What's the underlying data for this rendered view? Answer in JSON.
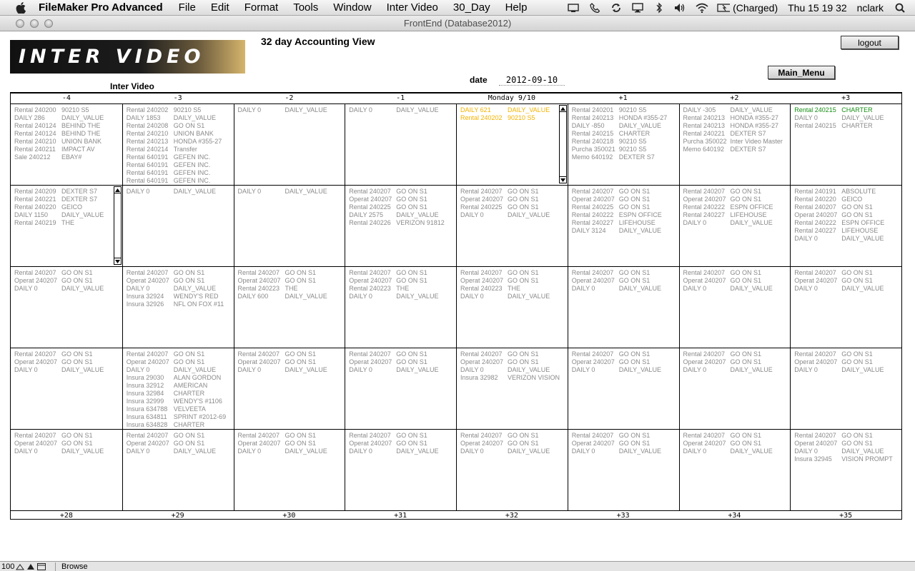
{
  "menubar": {
    "app_name": "FileMaker Pro Advanced",
    "items": [
      "File",
      "Edit",
      "Format",
      "Tools",
      "Window",
      "Inter Video",
      "30_Day",
      "Help"
    ],
    "battery": "(Charged)",
    "clock": "Thu 15 19 32",
    "user": "nclark"
  },
  "window": {
    "title": "FrontEnd (Database2012)"
  },
  "header": {
    "logo_text": "INTER VIDEO",
    "view_title": "32 day Accounting View",
    "company": "Inter Video",
    "date_label": "date",
    "date_value": "2012-09-10",
    "logout_label": "logout",
    "main_menu_label": "Main_Menu"
  },
  "calendar": {
    "headers": [
      "-4",
      "-3",
      "-2",
      "-1",
      "Monday 9/10",
      "+1",
      "+2",
      "+3"
    ],
    "footers": [
      "+28",
      "+29",
      "+30",
      "+31",
      "+32",
      "+33",
      "+34",
      "+35"
    ],
    "rows": [
      [
        [
          [
            "Rental  240200",
            "90210 S5"
          ],
          [
            "DAILY  286",
            "DAILY_VALUE"
          ],
          [
            "Rental  240124",
            "BEHIND THE"
          ],
          [
            "Rental  240124",
            "BEHIND THE"
          ],
          [
            "Rental  240210",
            "UNION BANK"
          ],
          [
            "Rental  240211",
            "IMPACT AV"
          ],
          [
            "Sale    240212",
            "EBAY#"
          ]
        ],
        [
          [
            "Rental  240202",
            "90210 S5"
          ],
          [
            "DAILY  1853",
            "DAILY_VALUE"
          ],
          [
            "Rental  240208",
            "GO ON S1"
          ],
          [
            "Rental  240210",
            "UNION BANK"
          ],
          [
            "Rental  240213",
            "HONDA #355-27"
          ],
          [
            "Rental  240214",
            "Transfer"
          ],
          [
            "Rental  640191",
            "GEFEN INC."
          ],
          [
            "Rental  640191",
            "GEFEN INC."
          ],
          [
            "Rental  640191",
            "GEFEN INC."
          ],
          [
            "Rental  640191",
            "GEFEN INC."
          ]
        ],
        [
          [
            "DAILY  0",
            "DAILY_VALUE"
          ]
        ],
        [
          [
            "DAILY  0",
            "DAILY_VALUE"
          ]
        ],
        [
          [
            "DAILY  621",
            "DAILY_VALUE"
          ],
          [
            "Rental  240202",
            "90210 S5"
          ]
        ],
        [
          [
            "Rental  240201",
            "90210 S5"
          ],
          [
            "Rental  240213",
            "HONDA #355-27"
          ],
          [
            "DAILY  -850",
            "DAILY_VALUE"
          ],
          [
            "Rental  240215",
            "CHARTER"
          ],
          [
            "Rental  240218",
            "90210 S5"
          ],
          [
            "Purcha  350021",
            "90210 S5"
          ],
          [
            "Memo   640192",
            "DEXTER S7"
          ]
        ],
        [
          [
            "DAILY  -305",
            "DAILY_VALUE"
          ],
          [
            "Rental  240213",
            "HONDA #355-27"
          ],
          [
            "Rental  240213",
            "HONDA #355-27"
          ],
          [
            "Rental  240221",
            "DEXTER S7"
          ],
          [
            "Purcha  350022",
            "Inter Video Master"
          ],
          [
            "Memo   640192",
            "DEXTER S7"
          ]
        ],
        [
          [
            "Rental  240215",
            "CHARTER"
          ],
          [
            "DAILY  0",
            "DAILY_VALUE"
          ],
          [
            "Rental  240215",
            "CHARTER"
          ]
        ]
      ],
      [
        [
          [
            "Rental  240209",
            "DEXTER S7"
          ],
          [
            "Rental  240221",
            "DEXTER S7"
          ],
          [
            "Rental  240220",
            "GEICO"
          ],
          [
            "DAILY  1150",
            "DAILY_VALUE"
          ],
          [
            "Rental  240219",
            "THE"
          ]
        ],
        [
          [
            "DAILY  0",
            "DAILY_VALUE"
          ]
        ],
        [
          [
            "DAILY  0",
            "DAILY_VALUE"
          ]
        ],
        [
          [
            "Rental  240207",
            "GO ON S1"
          ],
          [
            "Operat  240207",
            "GO ON S1"
          ],
          [
            "Rental  240225",
            "GO ON S1"
          ],
          [
            "DAILY  2575",
            "DAILY_VALUE"
          ],
          [
            "Rental  240226",
            "VERIZON 91812"
          ]
        ],
        [
          [
            "Rental  240207",
            "GO ON S1"
          ],
          [
            "Operat  240207",
            "GO ON S1"
          ],
          [
            "Rental  240225",
            "GO ON S1"
          ],
          [
            "DAILY  0",
            "DAILY_VALUE"
          ]
        ],
        [
          [
            "Rental  240207",
            "GO ON S1"
          ],
          [
            "Operat  240207",
            "GO ON S1"
          ],
          [
            "Rental  240225",
            "GO ON S1"
          ],
          [
            "Rental  240222",
            "ESPN OFFICE"
          ],
          [
            "Rental  240227",
            "LIFEHOUSE"
          ],
          [
            "DAILY  3124",
            "DAILY_VALUE"
          ]
        ],
        [
          [
            "Rental  240207",
            "GO ON S1"
          ],
          [
            "Operat  240207",
            "GO ON S1"
          ],
          [
            "Rental  240222",
            "ESPN OFFICE"
          ],
          [
            "Rental  240227",
            "LIFEHOUSE"
          ],
          [
            "DAILY  0",
            "DAILY_VALUE"
          ]
        ],
        [
          [
            "Rental  240191",
            "ABSOLUTE"
          ],
          [
            "Rental  240220",
            "GEICO"
          ],
          [
            "Rental  240207",
            "GO ON S1"
          ],
          [
            "Operat  240207",
            "GO ON S1"
          ],
          [
            "Rental  240222",
            "ESPN OFFICE"
          ],
          [
            "Rental  240227",
            "LIFEHOUSE"
          ],
          [
            "DAILY  0",
            "DAILY_VALUE"
          ]
        ]
      ],
      [
        [
          [
            "Rental  240207",
            "GO ON S1"
          ],
          [
            "Operat  240207",
            "GO ON S1"
          ],
          [
            "DAILY  0",
            "DAILY_VALUE"
          ]
        ],
        [
          [
            "Rental  240207",
            "GO ON S1"
          ],
          [
            "Operat  240207",
            "GO ON S1"
          ],
          [
            "DAILY  0",
            "DAILY_VALUE"
          ],
          [
            "Insura  32924",
            "WENDY'S RED"
          ],
          [
            "Insura  32926",
            "NFL ON FOX #11"
          ]
        ],
        [
          [
            "Rental  240207",
            "GO ON S1"
          ],
          [
            "Operat  240207",
            "GO ON S1"
          ],
          [
            "Rental  240223",
            "THE"
          ],
          [
            "DAILY  600",
            "DAILY_VALUE"
          ]
        ],
        [
          [
            "Rental  240207",
            "GO ON S1"
          ],
          [
            "Operat  240207",
            "GO ON S1"
          ],
          [
            "Rental  240223",
            "THE"
          ],
          [
            "DAILY  0",
            "DAILY_VALUE"
          ]
        ],
        [
          [
            "Rental  240207",
            "GO ON S1"
          ],
          [
            "Operat  240207",
            "GO ON S1"
          ],
          [
            "Rental  240223",
            "THE"
          ],
          [
            "DAILY  0",
            "DAILY_VALUE"
          ]
        ],
        [
          [
            "Rental  240207",
            "GO ON S1"
          ],
          [
            "Operat  240207",
            "GO ON S1"
          ],
          [
            "DAILY  0",
            "DAILY_VALUE"
          ]
        ],
        [
          [
            "Rental  240207",
            "GO ON S1"
          ],
          [
            "Operat  240207",
            "GO ON S1"
          ],
          [
            "DAILY  0",
            "DAILY_VALUE"
          ]
        ],
        [
          [
            "Rental  240207",
            "GO ON S1"
          ],
          [
            "Operat  240207",
            "GO ON S1"
          ],
          [
            "DAILY  0",
            "DAILY_VALUE"
          ]
        ]
      ],
      [
        [
          [
            "Rental  240207",
            "GO ON S1"
          ],
          [
            "Operat  240207",
            "GO ON S1"
          ],
          [
            "DAILY  0",
            "DAILY_VALUE"
          ]
        ],
        [
          [
            "Rental  240207",
            "GO ON S1"
          ],
          [
            "Operat  240207",
            "GO ON S1"
          ],
          [
            "DAILY  0",
            "DAILY_VALUE"
          ],
          [
            "Insura  29030",
            "ALAN GORDON"
          ],
          [
            "Insura  32912",
            "AMERICAN"
          ],
          [
            "Insura  32984",
            "CHARTER"
          ],
          [
            "Insura  32999",
            "WENDY'S #1106"
          ],
          [
            "Insura  634788",
            "VELVEETA"
          ],
          [
            "Insura  634811",
            "SPRINT #2012-69"
          ],
          [
            "Insura  634828",
            "CHARTER"
          ]
        ],
        [
          [
            "Rental  240207",
            "GO ON S1"
          ],
          [
            "Operat  240207",
            "GO ON S1"
          ],
          [
            "DAILY  0",
            "DAILY_VALUE"
          ]
        ],
        [
          [
            "Rental  240207",
            "GO ON S1"
          ],
          [
            "Operat  240207",
            "GO ON S1"
          ],
          [
            "DAILY  0",
            "DAILY_VALUE"
          ]
        ],
        [
          [
            "Rental  240207",
            "GO ON S1"
          ],
          [
            "Operat  240207",
            "GO ON S1"
          ],
          [
            "DAILY  0",
            "DAILY_VALUE"
          ],
          [
            "Insura  32982",
            "VERIZON VISION"
          ]
        ],
        [
          [
            "Rental  240207",
            "GO ON S1"
          ],
          [
            "Operat  240207",
            "GO ON S1"
          ],
          [
            "DAILY  0",
            "DAILY_VALUE"
          ]
        ],
        [
          [
            "Rental  240207",
            "GO ON S1"
          ],
          [
            "Operat  240207",
            "GO ON S1"
          ],
          [
            "DAILY  0",
            "DAILY_VALUE"
          ]
        ],
        [
          [
            "Rental  240207",
            "GO ON S1"
          ],
          [
            "Operat  240207",
            "GO ON S1"
          ],
          [
            "DAILY  0",
            "DAILY_VALUE"
          ]
        ]
      ],
      [
        [
          [
            "Rental  240207",
            "GO ON S1"
          ],
          [
            "Operat  240207",
            "GO ON S1"
          ],
          [
            "DAILY  0",
            "DAILY_VALUE"
          ]
        ],
        [
          [
            "Rental  240207",
            "GO ON S1"
          ],
          [
            "Operat  240207",
            "GO ON S1"
          ],
          [
            "DAILY  0",
            "DAILY_VALUE"
          ]
        ],
        [
          [
            "Rental  240207",
            "GO ON S1"
          ],
          [
            "Operat  240207",
            "GO ON S1"
          ],
          [
            "DAILY  0",
            "DAILY_VALUE"
          ]
        ],
        [
          [
            "Rental  240207",
            "GO ON S1"
          ],
          [
            "Operat  240207",
            "GO ON S1"
          ],
          [
            "DAILY  0",
            "DAILY_VALUE"
          ]
        ],
        [
          [
            "Rental  240207",
            "GO ON S1"
          ],
          [
            "Operat  240207",
            "GO ON S1"
          ],
          [
            "DAILY  0",
            "DAILY_VALUE"
          ]
        ],
        [
          [
            "Rental  240207",
            "GO ON S1"
          ],
          [
            "Operat  240207",
            "GO ON S1"
          ],
          [
            "DAILY  0",
            "DAILY_VALUE"
          ]
        ],
        [
          [
            "Rental  240207",
            "GO ON S1"
          ],
          [
            "Operat  240207",
            "GO ON S1"
          ],
          [
            "DAILY  0",
            "DAILY_VALUE"
          ]
        ],
        [
          [
            "Rental  240207",
            "GO ON S1"
          ],
          [
            "Operat  240207",
            "GO ON S1"
          ],
          [
            "DAILY  0",
            "DAILY_VALUE"
          ],
          [
            "Insura  32945",
            "VISION PROMPT"
          ]
        ]
      ]
    ],
    "highlight": {
      "today_color": "#f2b300",
      "charter_color": "#168f16"
    }
  },
  "statusbar": {
    "zoom": "100",
    "mode": "Browse"
  }
}
